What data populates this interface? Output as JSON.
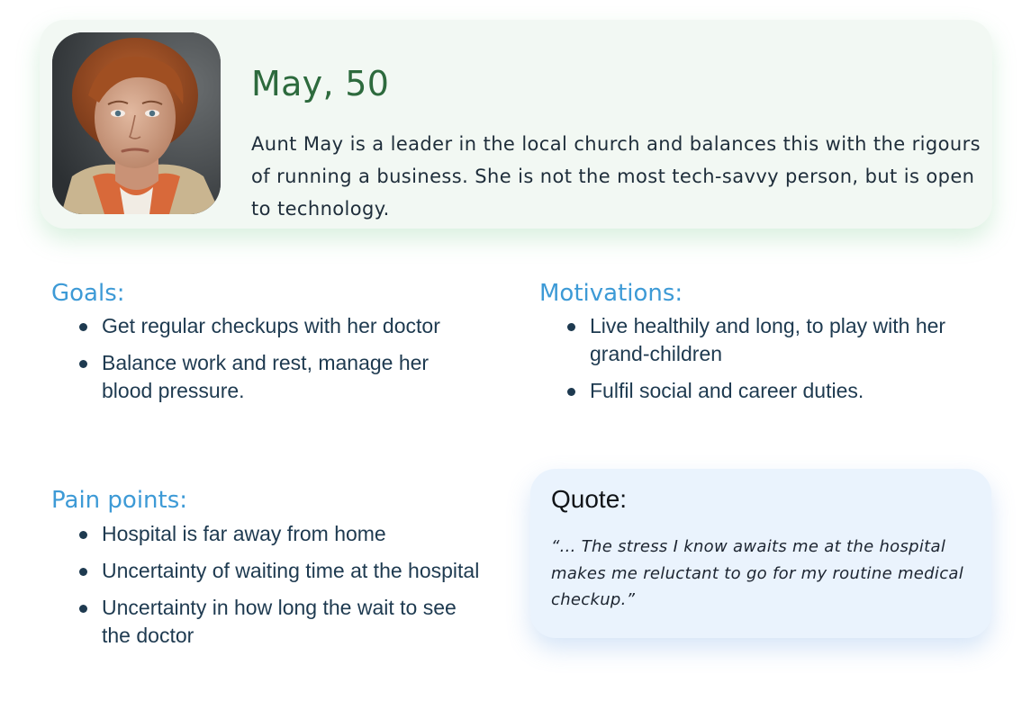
{
  "profile": {
    "photo_icon": "persona-portrait",
    "name": "May, 50",
    "description": "Aunt May is a leader in the local church and balances this with the rigours of running a business. She is not the most tech-savvy person, but is open to technology."
  },
  "goals": {
    "heading": "Goals:",
    "items": [
      "Get regular checkups with her doctor",
      "Balance work and rest, manage her blood pressure."
    ]
  },
  "motivations": {
    "heading": "Motivations:",
    "items": [
      "Live healthily and long, to play with her grand-children",
      "Fulfil social and career duties."
    ]
  },
  "pain_points": {
    "heading": "Pain points:",
    "items": [
      "Hospital is far away from home",
      "Uncertainty of waiting time at the hospital",
      "Uncertainty in how long the wait to see the doctor"
    ]
  },
  "quote": {
    "title": "Quote:",
    "text": "“... The stress I know awaits me at the hospital makes me reluctant to go for my routine medical checkup.”"
  },
  "colors": {
    "name_green": "#2d6a3d",
    "heading_blue": "#3d9ad6",
    "profile_card_bg": "#f2f8f3",
    "quote_card_bg": "#eaf3fd",
    "body_text": "#1e3a50"
  }
}
